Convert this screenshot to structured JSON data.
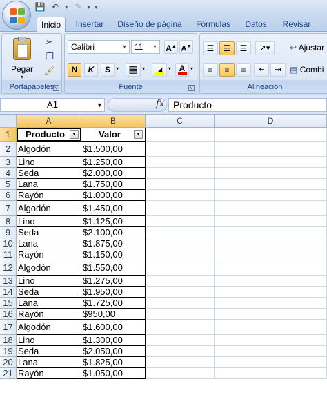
{
  "quick_access": {
    "icons": [
      "office-logo",
      "save-icon",
      "undo-icon",
      "redo-icon",
      "customize-icon"
    ]
  },
  "tabs": [
    {
      "label": "Inicio",
      "active": true
    },
    {
      "label": "Insertar"
    },
    {
      "label": "Diseño de página"
    },
    {
      "label": "Fórmulas"
    },
    {
      "label": "Datos"
    },
    {
      "label": "Revisar"
    }
  ],
  "ribbon": {
    "clipboard": {
      "label": "Portapapeles",
      "paste": "Pegar"
    },
    "font": {
      "label": "Fuente",
      "font_name": "Calibri",
      "font_size": "11",
      "grow": "A",
      "shrink": "A",
      "bold": "N",
      "italic": "K",
      "underline": "S",
      "fill_color": "#ffff00",
      "font_color": "#ff0000"
    },
    "alignment": {
      "label": "Alineación",
      "wrap": "Ajustar",
      "merge": "Combi"
    }
  },
  "formula_bar": {
    "name_box": "A1",
    "fx": "fx",
    "content": "Producto"
  },
  "columns": [
    "A",
    "B",
    "C",
    "D"
  ],
  "table": {
    "headers": [
      "Producto",
      "Valor"
    ],
    "rows": [
      [
        "Algodón",
        "$1.500,00"
      ],
      [
        "Lino",
        "$1.250,00"
      ],
      [
        "Seda",
        "$2.000,00"
      ],
      [
        "Lana",
        "$1.750,00"
      ],
      [
        "Rayón",
        "$1.000,00"
      ],
      [
        "Algodón",
        "$1.450,00"
      ],
      [
        "Lino",
        "$1.125,00"
      ],
      [
        "Seda",
        "$2.100,00"
      ],
      [
        "Lana",
        "$1.875,00"
      ],
      [
        "Rayón",
        "$1.150,00"
      ],
      [
        "Algodón",
        "$1.550,00"
      ],
      [
        "Lino",
        "$1.275,00"
      ],
      [
        "Seda",
        "$1.950,00"
      ],
      [
        "Lana",
        "$1.725,00"
      ],
      [
        "Rayón",
        "$950,00"
      ],
      [
        "Algodón",
        "$1.600,00"
      ],
      [
        "Lino",
        "$1.300,00"
      ],
      [
        "Seda",
        "$2.050,00"
      ],
      [
        "Lana",
        "$1.825,00"
      ],
      [
        "Rayón",
        "$1.050,00"
      ]
    ]
  },
  "row_numbers": [
    "1",
    "2",
    "3",
    "4",
    "5",
    "6",
    "7",
    "8",
    "9",
    "10",
    "11",
    "12",
    "13",
    "14",
    "15",
    "16",
    "17",
    "18",
    "19",
    "20",
    "21"
  ],
  "colors": {
    "accent": "#15428b",
    "selection": "#f4c462",
    "grid_line": "#d0d7e5"
  }
}
